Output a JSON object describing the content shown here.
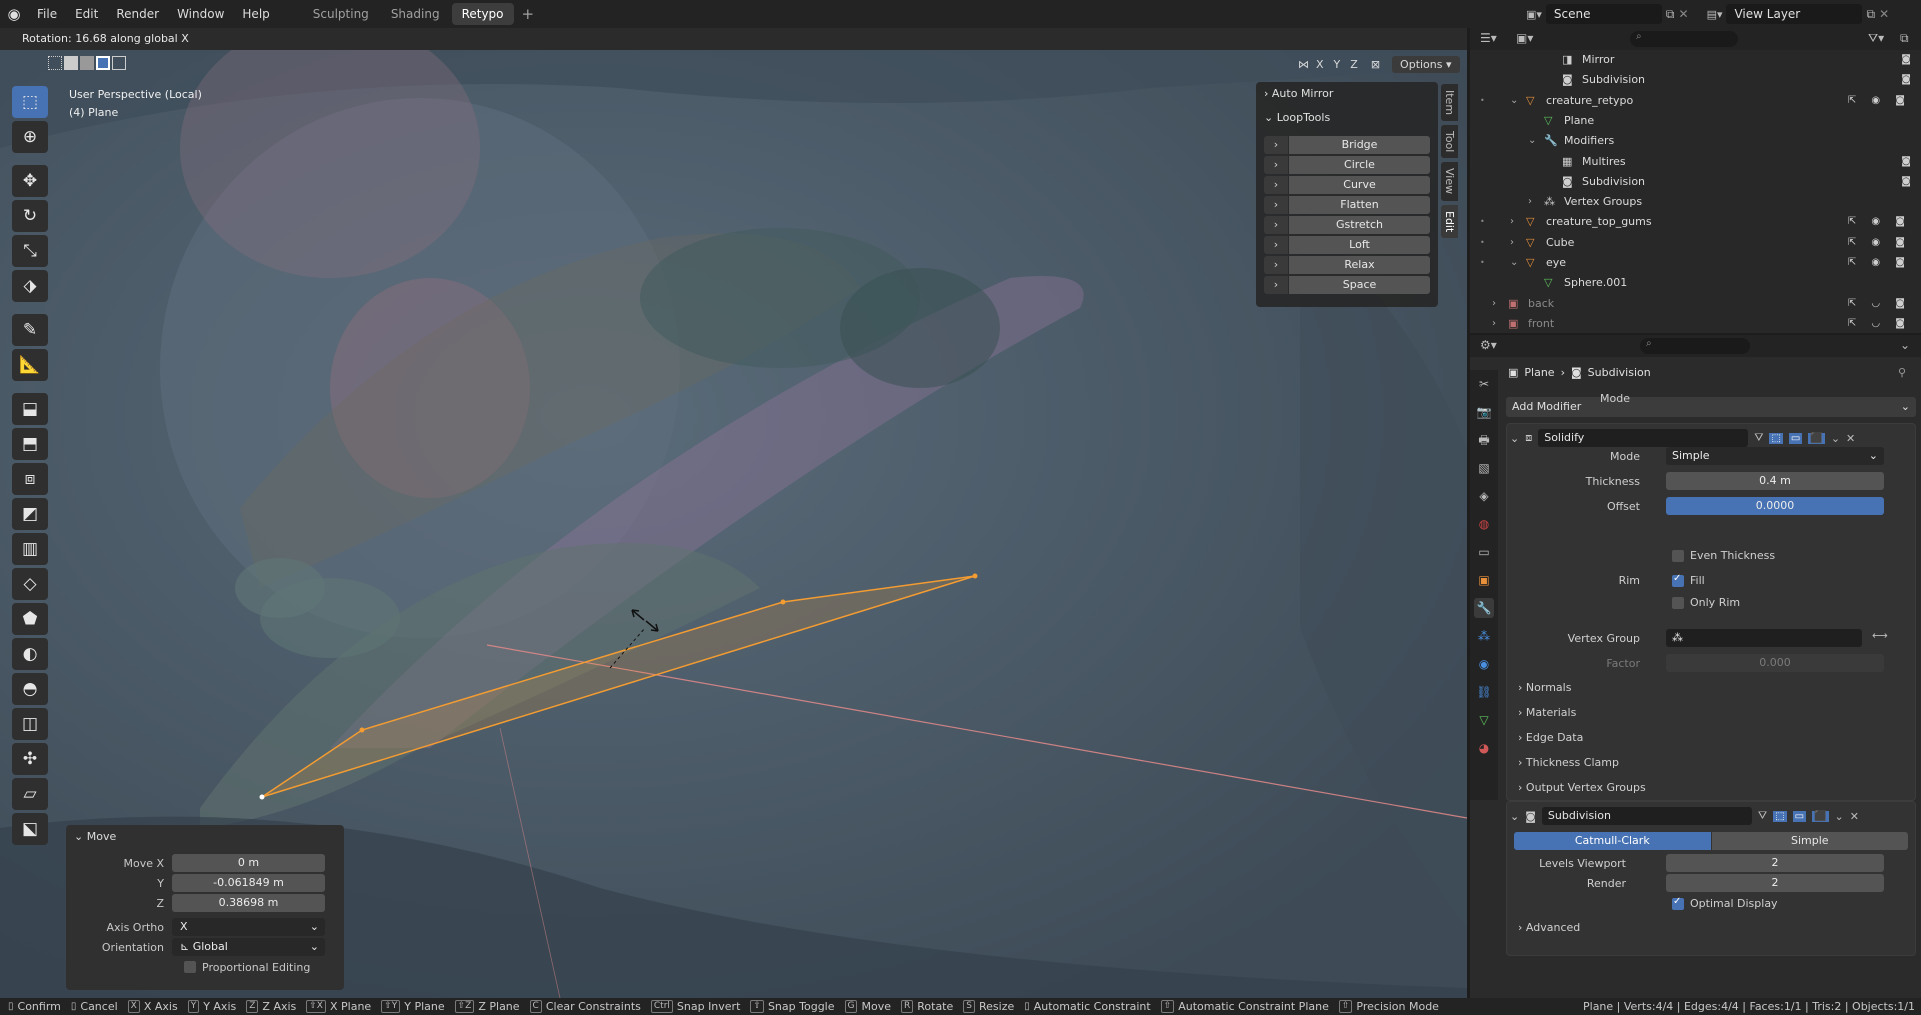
{
  "topbar": {
    "menus": [
      "File",
      "Edit",
      "Render",
      "Window",
      "Help"
    ],
    "workspaces": [
      "Sculpting",
      "Shading",
      "Retypo"
    ],
    "active_workspace": "Retypo",
    "scene": "Scene",
    "view_layer": "View Layer"
  },
  "viewport": {
    "operator_status": "Rotation: 16.68 along global X",
    "perspective": "User Perspective (Local)",
    "object": "(4) Plane",
    "axes": [
      "X",
      "Y",
      "Z"
    ],
    "options_label": "Options",
    "n_tabs": [
      "Item",
      "Tool",
      "View",
      "Edit"
    ],
    "auto_mirror": "Auto Mirror",
    "looptools": {
      "title": "LoopTools",
      "buttons": [
        "Bridge",
        "Circle",
        "Curve",
        "Flatten",
        "Gstretch",
        "Loft",
        "Relax",
        "Space"
      ]
    },
    "move_panel": {
      "title": "Move",
      "move_x_label": "Move X",
      "move_x": "0 m",
      "y_label": "Y",
      "y": "-0.061849 m",
      "z_label": "Z",
      "z": "0.38698 m",
      "axis_ortho_label": "Axis Ortho",
      "axis_ortho": "X",
      "orientation_label": "Orientation",
      "orientation": "Global",
      "proportional": "Proportional Editing"
    }
  },
  "outliner": {
    "items": [
      {
        "label": "Mirror",
        "indent": 4
      },
      {
        "label": "Subdivision",
        "indent": 4
      },
      {
        "label": "creature_retypo",
        "indent": 2
      },
      {
        "label": "Plane",
        "indent": 3
      },
      {
        "label": "Modifiers",
        "indent": 3
      },
      {
        "label": "Multires",
        "indent": 4
      },
      {
        "label": "Subdivision",
        "indent": 4
      },
      {
        "label": "Vertex Groups",
        "indent": 3
      },
      {
        "label": "creature_top_gums",
        "indent": 2
      },
      {
        "label": "Cube",
        "indent": 2
      },
      {
        "label": "eye",
        "indent": 2
      },
      {
        "label": "Sphere.001",
        "indent": 3
      },
      {
        "label": "back",
        "indent": 1
      },
      {
        "label": "front",
        "indent": 1
      }
    ]
  },
  "properties": {
    "breadcrumb_object": "Plane",
    "breadcrumb_modifier": "Subdivision",
    "add_modifier": "Add Modifier",
    "solidify": {
      "name": "Solidify",
      "mode_label": "Mode",
      "mode": "Simple",
      "thickness_label": "Thickness",
      "thickness": "0.4 m",
      "offset_label": "Offset",
      "offset": "0.0000",
      "even_thickness": "Even Thickness",
      "rim_label": "Rim",
      "fill": "Fill",
      "only_rim": "Only Rim",
      "vertex_group_label": "Vertex Group",
      "factor_label": "Factor",
      "factor": "0.000",
      "subpanels": [
        "Normals",
        "Materials",
        "Edge Data",
        "Thickness Clamp",
        "Output Vertex Groups"
      ]
    },
    "subdivision": {
      "name": "Subdivision",
      "catmull": "Catmull-Clark",
      "simple": "Simple",
      "levels_viewport_label": "Levels Viewport",
      "levels_viewport": "2",
      "render_label": "Render",
      "render": "2",
      "optimal_display": "Optimal Display",
      "advanced": "Advanced"
    }
  },
  "statusbar": {
    "items": [
      {
        "key": "",
        "label": "Confirm"
      },
      {
        "key": "",
        "label": "Cancel"
      },
      {
        "key": "X",
        "label": "X Axis"
      },
      {
        "key": "Y",
        "label": "Y Axis"
      },
      {
        "key": "Z",
        "label": "Z Axis"
      },
      {
        "key": "⇧X",
        "label": "X Plane"
      },
      {
        "key": "⇧Y",
        "label": "Y Plane"
      },
      {
        "key": "⇧Z",
        "label": "Z Plane"
      },
      {
        "key": "C",
        "label": "Clear Constraints"
      },
      {
        "key": "Ctrl",
        "label": "Snap Invert"
      },
      {
        "key": "⇧",
        "label": "Snap Toggle"
      },
      {
        "key": "G",
        "label": "Move"
      },
      {
        "key": "R",
        "label": "Rotate"
      },
      {
        "key": "S",
        "label": "Resize"
      },
      {
        "key": "",
        "label": "Automatic Constraint"
      },
      {
        "key": "⇧",
        "label": "Automatic Constraint Plane"
      },
      {
        "key": "⇧",
        "label": "Precision Mode"
      }
    ],
    "stats": "Plane | Verts:4/4 | Edges:4/4 | Faces:1/1 | Tris:2 | Objects:1/1"
  },
  "colors": {
    "accent": "#4772b3",
    "selection": "#f39c32",
    "viewport_bg": "#4d5c6a"
  }
}
